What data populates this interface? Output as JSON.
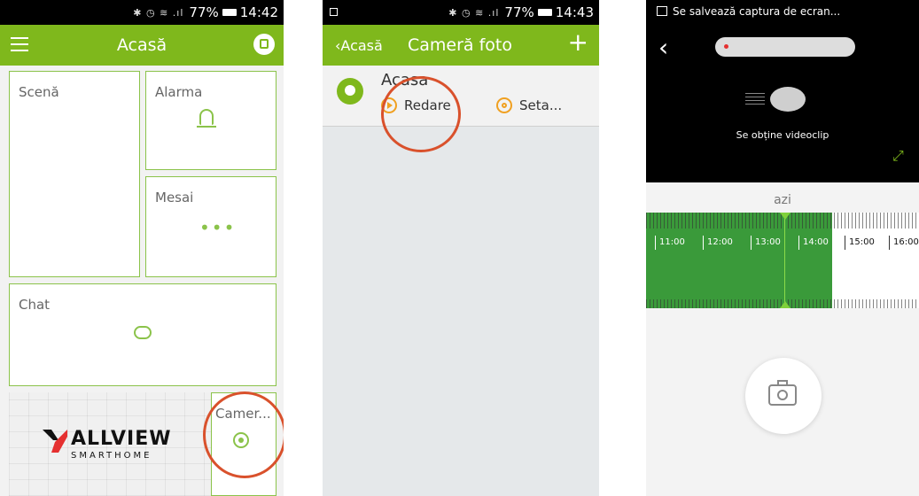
{
  "screen1": {
    "status": {
      "battery": "77%",
      "time": "14:42"
    },
    "header": {
      "title": "Acasă"
    },
    "tiles": {
      "scene": "Scenă",
      "alarm": "Alarma",
      "message": "Mesai",
      "message_dots": "•••",
      "chat": "Chat",
      "camera": "Camer..."
    },
    "logo": {
      "name": "ALLVIEW",
      "sub": "SMARTHOME"
    }
  },
  "screen2": {
    "status": {
      "battery": "77%",
      "time": "14:43"
    },
    "header": {
      "back": "‹Acasă",
      "title": "Cameră foto",
      "add": "+"
    },
    "device": {
      "name": "Acasa",
      "play_label": "Redare",
      "settings_label": "Seta..."
    }
  },
  "screen3": {
    "notification": "Se salvează captura de ecran...",
    "loading_text": "Se obține videoclip",
    "date_label": "azi",
    "timeline_hours": [
      "11:00",
      "12:00",
      "13:00",
      "14:00",
      "15:00",
      "16:00"
    ],
    "colors": {
      "recorded": "#3a9a3a",
      "accent": "#7fb81c"
    }
  }
}
